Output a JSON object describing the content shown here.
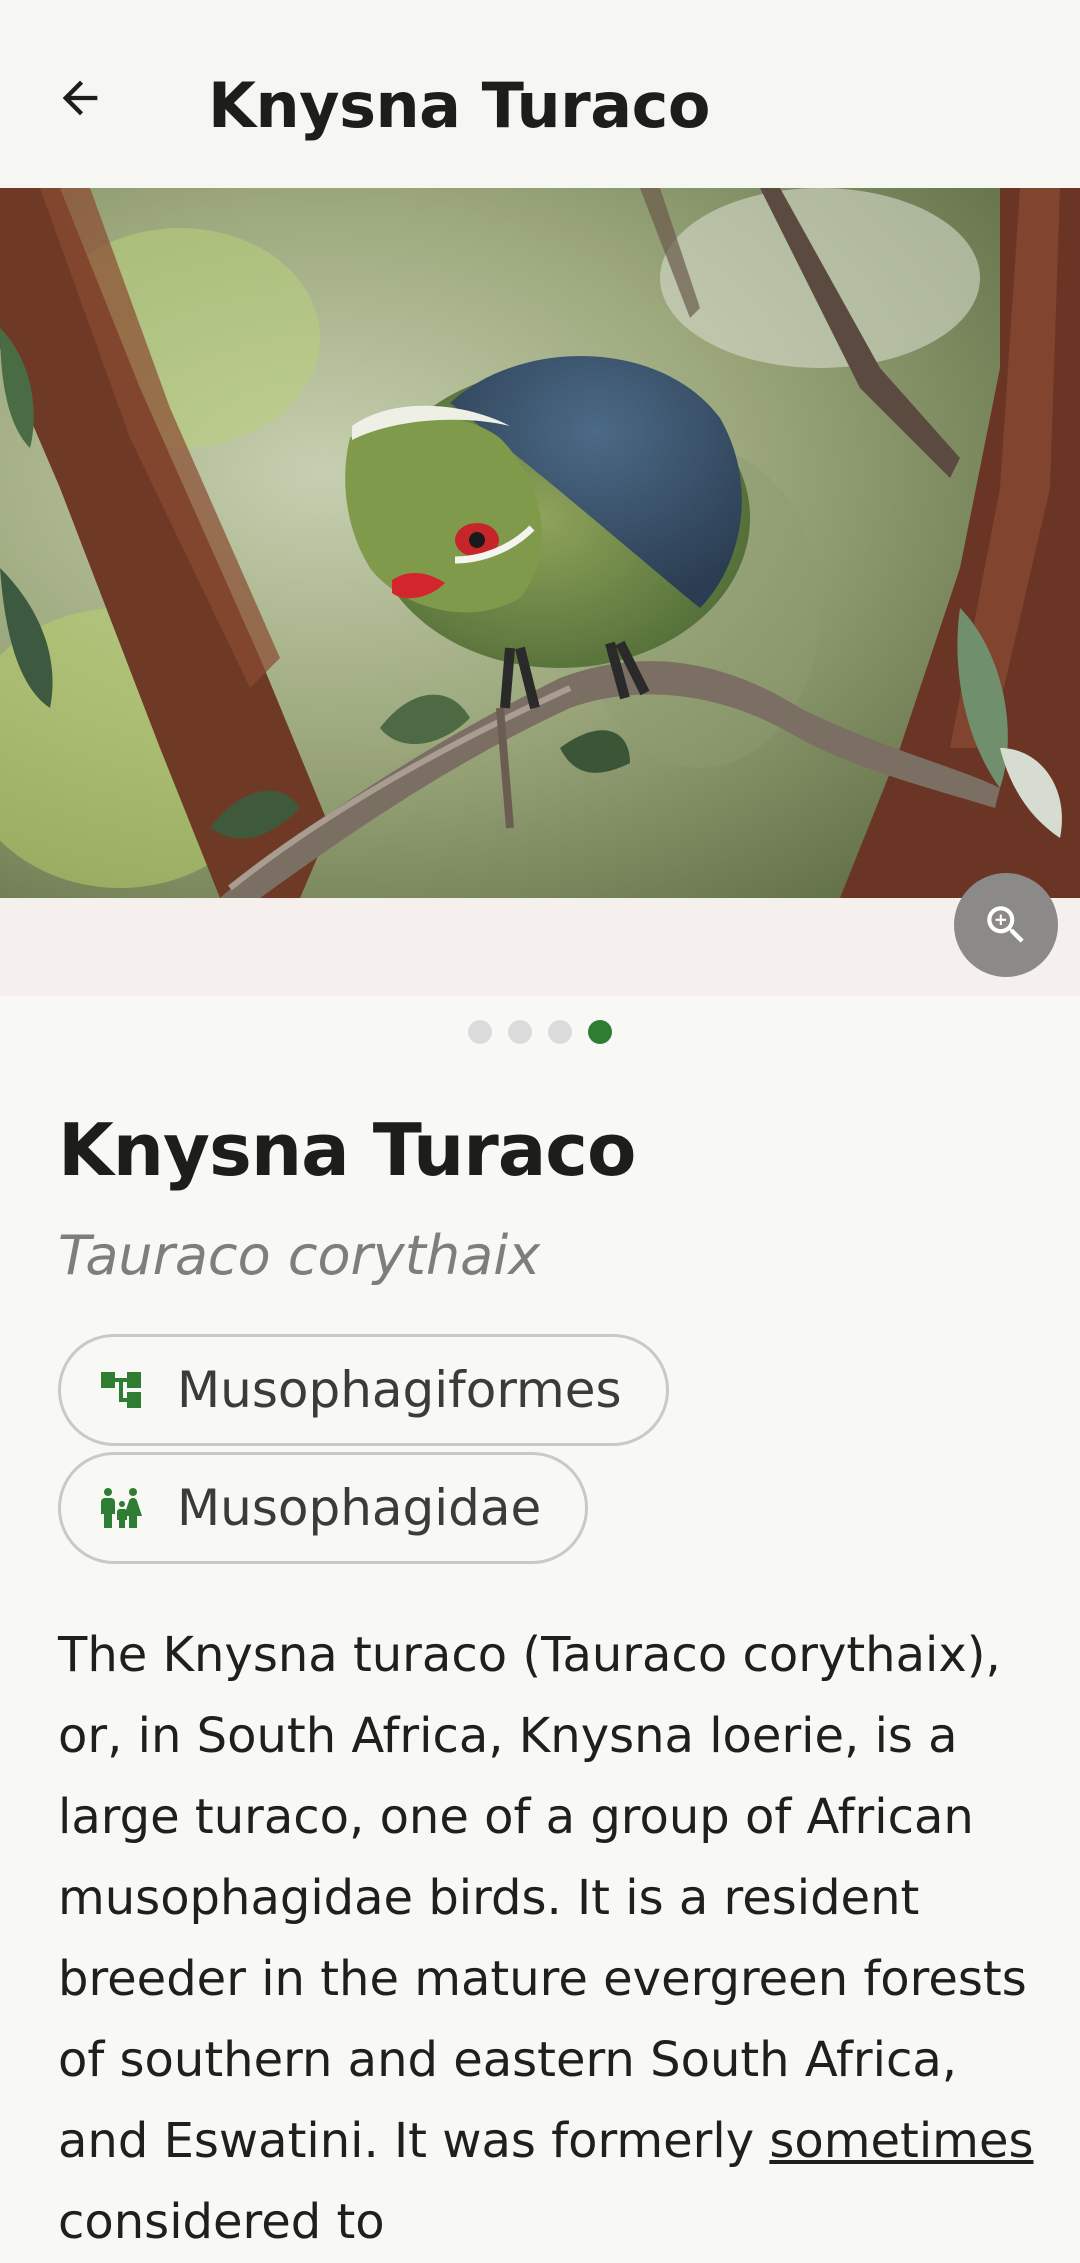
{
  "appbar": {
    "title": "Knysna Turaco",
    "back_icon": "arrow-back-icon"
  },
  "gallery": {
    "image_alt": "Knysna Turaco photo",
    "zoom_icon": "zoom-in-icon",
    "page_count": 4,
    "active_index": 3
  },
  "species": {
    "common_name": "Knysna Turaco",
    "scientific_name": "Tauraco corythaix",
    "order": "Musophagiformes",
    "order_icon": "hierarchy-icon",
    "family": "Musophagidae",
    "family_icon": "family-icon"
  },
  "description": {
    "text_before": "The Knysna turaco (Tauraco corythaix), or, in South Africa, Knysna loerie, is a large turaco, one of a group of African musophagidae birds. It is a resident breeder in the mature evergreen forests of southern and eastern South Africa, and Eswatini. It was formerly ",
    "link_text": "sometimes",
    "text_after": " considered to"
  },
  "colors": {
    "accent": "#2e7d32",
    "chip_border": "#c9c9c6",
    "background": "#f8f8f5"
  }
}
